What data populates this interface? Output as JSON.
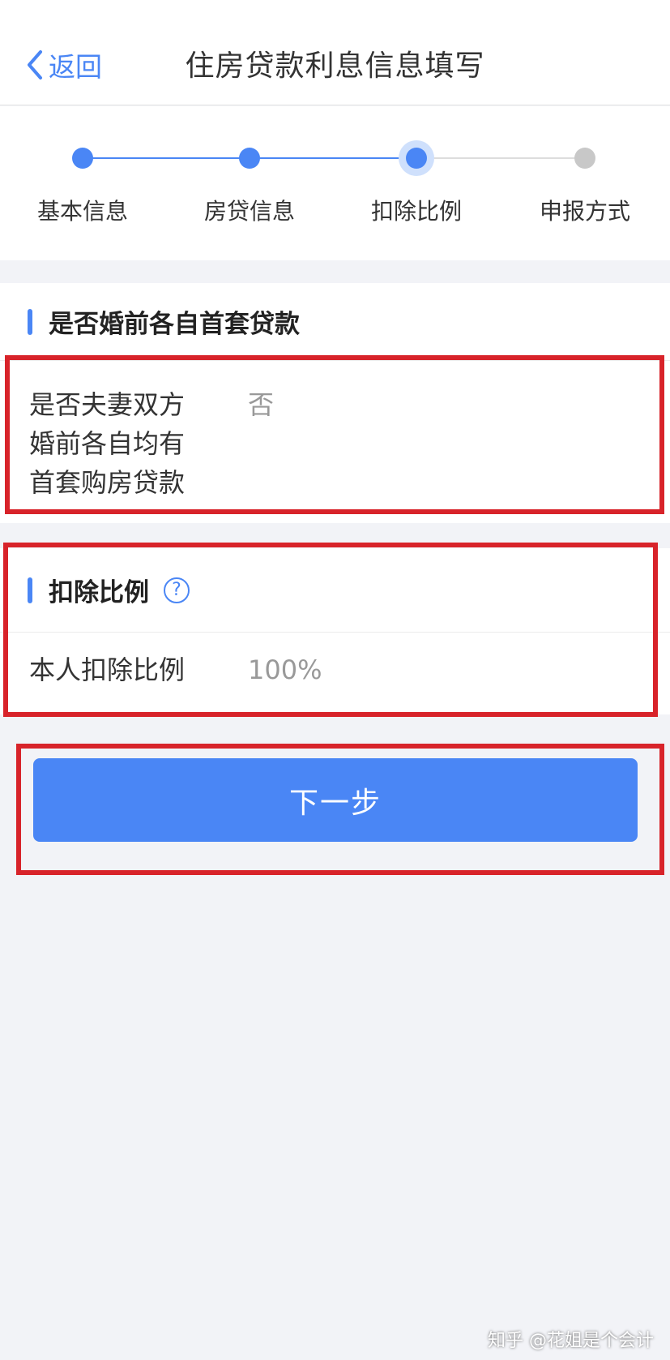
{
  "header": {
    "back_label": "返回",
    "title": "住房贷款利息信息填写"
  },
  "stepper": {
    "steps": [
      {
        "label": "基本信息",
        "status": "done"
      },
      {
        "label": "房贷信息",
        "status": "done"
      },
      {
        "label": "扣除比例",
        "status": "current"
      },
      {
        "label": "申报方式",
        "status": "pending"
      }
    ]
  },
  "section_premarital": {
    "title": "是否婚前各自首套贷款",
    "field_label_lines": [
      "是否夫妻双方",
      "婚前各自均有",
      "首套购房贷款"
    ],
    "field_value": "否"
  },
  "section_ratio": {
    "title": "扣除比例",
    "field_label": "本人扣除比例",
    "field_value": "100%"
  },
  "actions": {
    "next_label": "下一步"
  },
  "watermark": "知乎 @花姐是个会计",
  "colors": {
    "accent": "#4a86f5",
    "highlight_box": "#d8232a",
    "background": "#f2f3f7"
  }
}
